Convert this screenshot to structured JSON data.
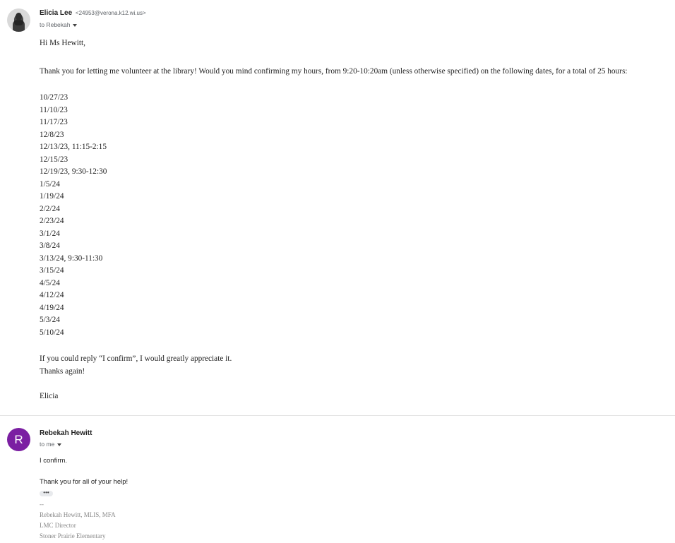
{
  "message1": {
    "sender_name": "Elicia Lee",
    "sender_email": "<24953@verona.k12.wi.us>",
    "to_text": "to Rebekah",
    "greeting": "Hi Ms Hewitt,",
    "intro": "Thank you for letting me volunteer at the library! Would you mind confirming my hours, from 9:20-10:20am (unless otherwise specified) on the following dates, for a total of 25 hours:",
    "dates": [
      "10/27/23",
      "11/10/23",
      "11/17/23",
      "12/8/23",
      "12/13/23, 11:15-2:15",
      "12/15/23",
      "12/19/23, 9:30-12:30",
      "1/5/24",
      "1/19/24",
      "2/2/24",
      "2/23/24",
      "3/1/24",
      "3/8/24",
      "3/13/24, 9:30-11:30",
      "3/15/24",
      "4/5/24",
      "4/12/24",
      "4/19/24",
      "5/3/24",
      "5/10/24"
    ],
    "closing1": "If you could reply “I confirm”, I would greatly appreciate it.",
    "closing2": "Thanks again!",
    "signoff": "Elicia"
  },
  "message2": {
    "avatar_letter": "R",
    "avatar_color": "#7b1fa2",
    "sender_name": "Rebekah Hewitt",
    "to_text": "to me",
    "line1": "I confirm.",
    "line2": "Thank you for all of your help!",
    "ellipsis": "•••",
    "sig_dash": "--",
    "sig_name": "Rebekah Hewitt, MLIS, MFA",
    "sig_title": "LMC Director",
    "sig_org": "Stoner Prairie Elementary"
  }
}
